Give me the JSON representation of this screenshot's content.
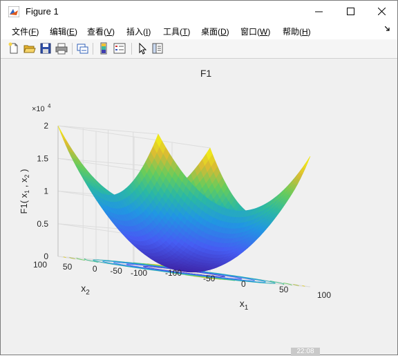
{
  "window": {
    "title": "Figure 1"
  },
  "menu": [
    {
      "label": "文件(",
      "key": "F",
      "end": ")"
    },
    {
      "label": "编辑(",
      "key": "E",
      "end": ")"
    },
    {
      "label": "查看(",
      "key": "V",
      "end": ")"
    },
    {
      "label": "插入(",
      "key": "I",
      "end": ")"
    },
    {
      "label": "工具(",
      "key": "T",
      "end": ")"
    },
    {
      "label": "桌面(",
      "key": "D",
      "end": ")"
    },
    {
      "label": "窗口(",
      "key": "W",
      "end": ")"
    },
    {
      "label": "帮助(",
      "key": "H",
      "end": ")"
    }
  ],
  "toolbar_icons": [
    "new-figure-icon",
    "open-file-icon",
    "save-icon",
    "print-icon",
    "link-plot-icon",
    "insert-colorbar-icon",
    "insert-legend-icon",
    "edit-plot-arrow-icon",
    "property-inspector-icon"
  ],
  "status": {
    "text": "22:08"
  },
  "chart_data": {
    "type": "surface",
    "function": "z = x1^2 + x2^2",
    "title": "F1",
    "xlabel": "x1",
    "ylabel": "x2",
    "zlabel": "F1( x1 , x2 )",
    "x_ticks": [
      -100,
      -50,
      0,
      50,
      100
    ],
    "y_ticks": [
      -100,
      -50,
      0,
      50,
      100
    ],
    "z_ticks": [
      0,
      0.5,
      1,
      1.5,
      2
    ],
    "z_exponent": "×10^4",
    "xlim": [
      -100,
      100
    ],
    "ylim": [
      -100,
      100
    ],
    "zlim": [
      0,
      20000
    ],
    "colormap": "parula",
    "contour_levels": 10,
    "grid": true,
    "colors": {
      "low": "#3e26a8",
      "mid": "#2bb8a4",
      "high": "#f9fb0e"
    }
  }
}
